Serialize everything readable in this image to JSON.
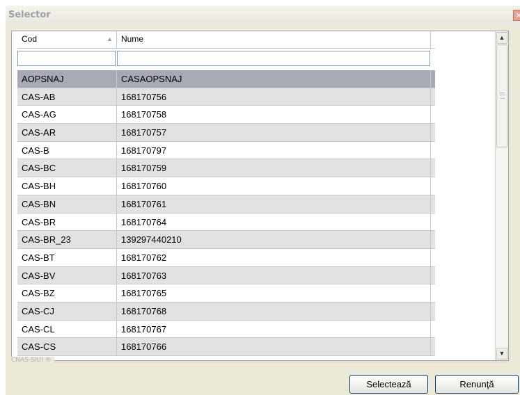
{
  "window": {
    "title": "Selector",
    "close_icon": "close-icon"
  },
  "grid": {
    "columns": [
      {
        "label": "Cod",
        "sort": "ascending"
      },
      {
        "label": "Nume"
      }
    ],
    "filters": {
      "cod_value": "",
      "nume_value": ""
    },
    "rows": [
      {
        "cod": "AOPSNAJ",
        "nume": "CASAOPSNAJ",
        "selected": true
      },
      {
        "cod": "CAS-AB",
        "nume": "168170756"
      },
      {
        "cod": "CAS-AG",
        "nume": "168170758"
      },
      {
        "cod": "CAS-AR",
        "nume": "168170757"
      },
      {
        "cod": "CAS-B",
        "nume": "168170797"
      },
      {
        "cod": "CAS-BC",
        "nume": "168170759"
      },
      {
        "cod": "CAS-BH",
        "nume": "168170760"
      },
      {
        "cod": "CAS-BN",
        "nume": "168170761"
      },
      {
        "cod": "CAS-BR",
        "nume": "168170764"
      },
      {
        "cod": "CAS-BR_23",
        "nume": "139297440210"
      },
      {
        "cod": "CAS-BT",
        "nume": "168170762"
      },
      {
        "cod": "CAS-BV",
        "nume": "168170763"
      },
      {
        "cod": "CAS-BZ",
        "nume": "168170765"
      },
      {
        "cod": "CAS-CJ",
        "nume": "168170768"
      },
      {
        "cod": "CAS-CL",
        "nume": "168170767"
      },
      {
        "cod": "CAS-CS",
        "nume": "168170766"
      }
    ]
  },
  "footer": {
    "brand": "CNAS-SIUI ®",
    "select_label": "Selectează",
    "cancel_label": "Renunţă"
  }
}
